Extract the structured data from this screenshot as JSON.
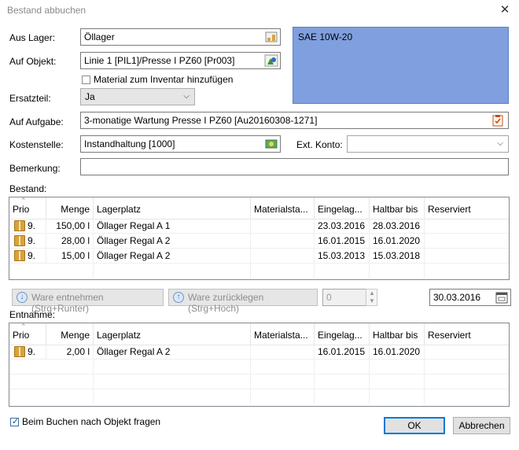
{
  "window": {
    "title": "Bestand abbuchen",
    "close": "✕"
  },
  "form": {
    "aus_lager_label": "Aus Lager:",
    "aus_lager_value": "Öllager",
    "auf_objekt_label": "Auf Objekt:",
    "auf_objekt_value": "Linie 1 [PIL1]/Presse I PZ60 [Pr003]",
    "material_inventar_label": "Material zum Inventar hinzufügen",
    "ersatzteil_label": "Ersatzteil:",
    "ersatzteil_value": "Ja",
    "auf_aufgabe_label": "Auf Aufgabe:",
    "auf_aufgabe_value": "3-monatige Wartung Presse I PZ60 [Au20160308-1271]",
    "kostenstelle_label": "Kostenstelle:",
    "kostenstelle_value": "Instandhaltung [1000]",
    "ext_konto_label": "Ext. Konto:",
    "ext_konto_value": "",
    "bemerkung_label": "Bemerkung:",
    "bemerkung_value": ""
  },
  "material_panel": {
    "name": "SAE 10W-20"
  },
  "bestand": {
    "label": "Bestand:",
    "columns": [
      "Prio",
      "Menge",
      "Lagerplatz",
      "Materialsta...",
      "Eingelag...",
      "Haltbar bis",
      "Reserviert"
    ],
    "rows": [
      {
        "prio": "9.",
        "menge": "150,00 l",
        "lagerplatz": "Öllager Regal A 1",
        "materialstatus": "",
        "eingelagert": "23.03.2016",
        "haltbar": "28.03.2016",
        "reserviert": ""
      },
      {
        "prio": "9.",
        "menge": "28,00 l",
        "lagerplatz": "Öllager Regal A 2",
        "materialstatus": "",
        "eingelagert": "16.01.2015",
        "haltbar": "16.01.2020",
        "reserviert": ""
      },
      {
        "prio": "9.",
        "menge": "15,00 l",
        "lagerplatz": "Öllager Regal A 2",
        "materialstatus": "",
        "eingelagert": "15.03.2013",
        "haltbar": "15.03.2018",
        "reserviert": ""
      }
    ]
  },
  "actions": {
    "entnehmen": "Ware entnehmen (Strg+Runter)",
    "zuruecklegen": "Ware zurücklegen (Strg+Hoch)",
    "quantity": "0",
    "date": "30.03.2016"
  },
  "entnahme": {
    "label": "Entnahme:",
    "columns": [
      "Prio",
      "Menge",
      "Lagerplatz",
      "Materialsta...",
      "Eingelag...",
      "Haltbar bis",
      "Reserviert"
    ],
    "rows": [
      {
        "prio": "9.",
        "menge": "2,00 l",
        "lagerplatz": "Öllager Regal A 2",
        "materialstatus": "",
        "eingelagert": "16.01.2015",
        "haltbar": "16.01.2020",
        "reserviert": ""
      }
    ]
  },
  "footer": {
    "ask_object_label": "Beim Buchen nach Objekt fragen",
    "ask_object_checked": true,
    "ok": "OK",
    "cancel": "Abbrechen"
  }
}
